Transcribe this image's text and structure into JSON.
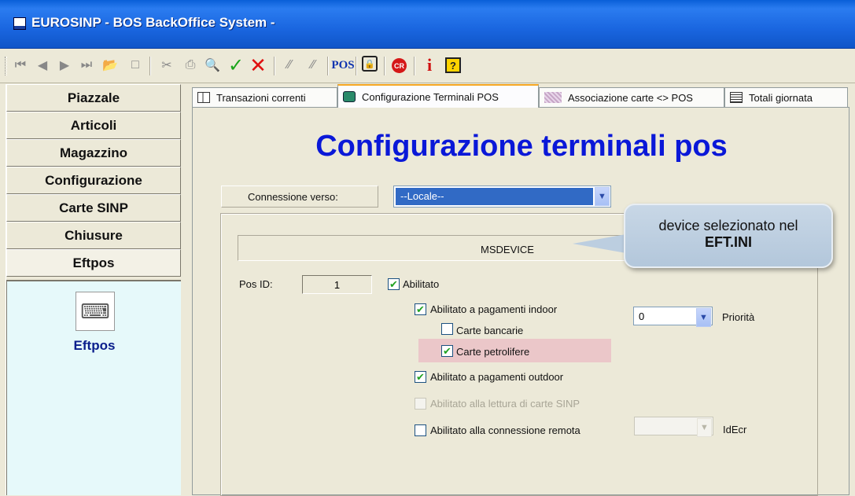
{
  "window": {
    "title": "EUROSINP - BOS BackOffice System -"
  },
  "toolbar": {
    "buttons": [
      "first-icon",
      "prev-icon",
      "next-icon",
      "last-icon",
      "open-folder-icon",
      "new-document-icon",
      "cut-icon",
      "print-icon",
      "search-icon",
      "confirm-icon",
      "cancel-icon",
      "pen-icon",
      "pen2-icon",
      "pos-icon",
      "lock-icon",
      "cr-icon",
      "info-icon",
      "help-icon"
    ],
    "pos_label": "POS",
    "cr_label": "CR",
    "info_label": "i",
    "help_label": "?"
  },
  "sidebar": {
    "items": [
      {
        "label": "Piazzale"
      },
      {
        "label": "Articoli"
      },
      {
        "label": "Magazzino"
      },
      {
        "label": "Configurazione"
      },
      {
        "label": "Carte SINP"
      },
      {
        "label": "Chiusure"
      },
      {
        "label": "Eftpos"
      }
    ],
    "active_module": {
      "label": "Eftpos",
      "icon": "card-reader-icon"
    }
  },
  "tabs": [
    {
      "label": "Transazioni correnti"
    },
    {
      "label": "Configurazione Terminali POS"
    },
    {
      "label": "Associazione carte <> POS"
    },
    {
      "label": "Totali giornata"
    }
  ],
  "main": {
    "title": "Configurazione terminali pos",
    "connection": {
      "label": "Connessione verso:",
      "value": "--Locale--"
    },
    "device_name": "MSDEVICE",
    "pos_id": {
      "label": "Pos ID:",
      "value": "1"
    },
    "options": {
      "abilitato": {
        "label": "Abilitato",
        "checked": true
      },
      "indoor": {
        "label": "Abilitato a pagamenti indoor",
        "checked": true
      },
      "carte_bancarie": {
        "label": "Carte bancarie",
        "checked": false
      },
      "carte_petrolifere": {
        "label": "Carte petrolifere",
        "checked": true
      },
      "outdoor": {
        "label": "Abilitato a pagamenti outdoor",
        "checked": true
      },
      "lettura_sinp": {
        "label": "Abilitato alla lettura di carte SINP",
        "checked": false,
        "disabled": true
      },
      "remota": {
        "label": "Abilitato alla connessione remota",
        "checked": false
      }
    },
    "priority": {
      "value": "0",
      "label": "Priorità"
    },
    "idecr": {
      "label": "IdEcr"
    }
  },
  "tooltip": {
    "line1": "device selezionato nel",
    "line2": "EFT.INI"
  },
  "colors": {
    "title_blue": "#0a18d8",
    "titlebar": "#1a66e0",
    "highlight": "#ebc7c9",
    "selection": "#316ac5"
  }
}
